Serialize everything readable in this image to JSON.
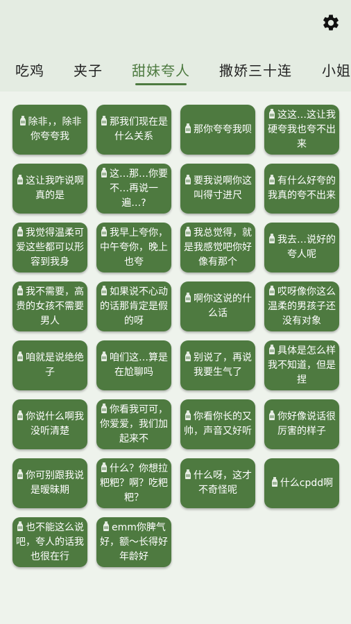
{
  "header": {
    "settings_icon": "gear-icon",
    "tabs": [
      {
        "label": "吃鸡"
      },
      {
        "label": "夹子"
      },
      {
        "label": "甜妹夸人",
        "active": true
      },
      {
        "label": "撒娇三十连"
      },
      {
        "label": "小姐"
      }
    ]
  },
  "cards": [
    {
      "icon": "bottle-icon",
      "text": "除非，，除非你夸夸我"
    },
    {
      "icon": "bottle-icon",
      "text": "那我们现在是什么关系"
    },
    {
      "icon": "bottle-icon",
      "text": "那你夸夸我呗"
    },
    {
      "icon": "bottle-icon",
      "text": "这这…这让我硬夸我也夸不出来"
    },
    {
      "icon": "bottle-icon",
      "text": "这让我咋说啊真的是"
    },
    {
      "icon": "bottle-icon",
      "text": "这…那…你要不…再说一遍…?"
    },
    {
      "icon": "bottle-icon",
      "text": "要我说啊你这叫得寸进尺"
    },
    {
      "icon": "bottle-icon",
      "text": "有什么好夸的我真的夸不出来"
    },
    {
      "icon": "bottle-icon",
      "text": "我觉得温柔可爱这些都可以形容到我身"
    },
    {
      "icon": "bottle-icon",
      "text": "我早上夸你，中午夸你，晚上也夸"
    },
    {
      "icon": "bottle-icon",
      "text": "我总觉得，就是我感觉吧你好像有那个"
    },
    {
      "icon": "bottle-icon",
      "text": "我去…说好的夸人呢"
    },
    {
      "icon": "bottle-icon",
      "text": "我不需要，高贵的女孩不需要男人"
    },
    {
      "icon": "bottle-icon",
      "text": "如果说不心动的话那肯定是假的呀"
    },
    {
      "icon": "bottle-icon",
      "text": "啊你这说的什么话"
    },
    {
      "icon": "bottle-icon",
      "text": "哎呀像你这么温柔的男孩子还没有对象"
    },
    {
      "icon": "bottle-icon",
      "text": "咱就是说绝绝子"
    },
    {
      "icon": "bottle-icon",
      "text": "咱们这…算是在尬聊吗"
    },
    {
      "icon": "bottle-icon",
      "text": "别说了，再说我要生气了"
    },
    {
      "icon": "bottle-icon",
      "text": "具体是怎么样我不知道，但是捏"
    },
    {
      "icon": "bottle-icon",
      "text": "你说什么啊我没听清楚"
    },
    {
      "icon": "bottle-icon",
      "text": "你看我可可，你爱爱，我们加起来不"
    },
    {
      "icon": "bottle-icon",
      "text": "你看你长的又帅，声音又好听"
    },
    {
      "icon": "bottle-icon",
      "text": "你好像说话很厉害的样子"
    },
    {
      "icon": "bottle-icon",
      "text": "你可别跟我说是暧昧期"
    },
    {
      "icon": "bottle-icon",
      "text": "什么？你想拉粑粑？啊？吃粑粑？"
    },
    {
      "icon": "bottle-icon",
      "text": "什么呀，这才不奇怪呢"
    },
    {
      "icon": "bottle-icon",
      "text": "什么cpdd啊"
    },
    {
      "icon": "bottle-icon",
      "text": "也不能这么说吧，夸人的话我也很在行"
    },
    {
      "icon": "bottle-icon",
      "text": "emm你脾气好，额～长得好年龄好"
    }
  ]
}
